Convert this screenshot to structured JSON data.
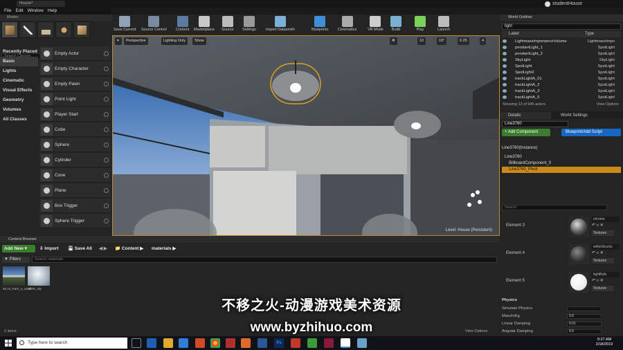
{
  "window": {
    "tab_title": "House*",
    "project": "studentHouse"
  },
  "menu": [
    "File",
    "Edit",
    "Window",
    "Help"
  ],
  "modes": {
    "title": "Modes",
    "search_placeholder": "Search Classes",
    "categories": [
      "Recently Placed",
      "Basic",
      "Lights",
      "Cinematic",
      "Visual Effects",
      "Geometry",
      "Volumes",
      "All Classes"
    ],
    "selected_category": "Basic",
    "actors": [
      "Empty Actor",
      "Empty Character",
      "Empty Pawn",
      "Point Light",
      "Player Start",
      "Cube",
      "Sphere",
      "Cylinder",
      "Cone",
      "Plane",
      "Box Trigger",
      "Sphere Trigger"
    ]
  },
  "toolbar": [
    "Save Current",
    "Source Control",
    "Content",
    "Marketplace",
    "Source",
    "Settings",
    "Import Datasmith",
    "Blueprints",
    "Cinematics",
    "VR Mode",
    "Build",
    "Play",
    "Launch"
  ],
  "viewport": {
    "perspective": "Perspective",
    "lighting": "Lighting Only",
    "show": "Show",
    "grid": "10",
    "angle": "10°",
    "scale": "0.25",
    "cam": "4",
    "level_label": "Level:",
    "level_name": "House (Persistent)"
  },
  "outliner": {
    "title": "World Outliner",
    "search": "light",
    "col_label": "Label",
    "col_type": "Type",
    "rows": [
      {
        "name": "LightmassImportanceVolume",
        "type": "LightmassImpo"
      },
      {
        "name": "pendantLight_1",
        "type": "SpotLight"
      },
      {
        "name": "pendantLight_2",
        "type": "SpotLight"
      },
      {
        "name": "SkyLight",
        "type": "SkyLight"
      },
      {
        "name": "SpotLight",
        "type": "SpotLight"
      },
      {
        "name": "SpotLight2",
        "type": "SpotLight"
      },
      {
        "name": "trackLightA_01",
        "type": "SpotLight"
      },
      {
        "name": "trackLightA_2",
        "type": "SpotLight"
      },
      {
        "name": "trackLightA_3",
        "type": "SpotLight"
      },
      {
        "name": "trackLightA_5",
        "type": "SpotLight"
      }
    ],
    "footer": "Showing 13 of 546 actors",
    "view_options": "View Options"
  },
  "details": {
    "tab_details": "Details",
    "tab_world": "World Settings",
    "name": "Line3760",
    "add_component": "+ Add Component",
    "blueprint": "Blueprint/Add Script",
    "instance": "Line3760(Instance)",
    "components": [
      "Line3760",
      "BillboardComponent_0",
      "Line3760_Pivot"
    ],
    "search": "Search",
    "elements": [
      {
        "label": "Element 3",
        "material": "chrome",
        "tex": "Textures"
      },
      {
        "label": "Element 4",
        "material": "whiteStructu",
        "tex": "Textures"
      },
      {
        "label": "Element 5",
        "material": "lightBulb",
        "tex": "Textures"
      }
    ],
    "physics_title": "Physics",
    "physics": [
      {
        "label": "Simulate Physics",
        "value": ""
      },
      {
        "label": "MassInKg",
        "value": "0.0"
      },
      {
        "label": "Linear Damping",
        "value": "0.01"
      },
      {
        "label": "Angular Damping",
        "value": "0.0"
      }
    ]
  },
  "content": {
    "title": "Content Browser",
    "add_new": "Add New",
    "import": "Import",
    "save_all": "Save All",
    "path": [
      "Content",
      "materials"
    ],
    "filters": "Filters",
    "search_placeholder": "Search materials",
    "assets": [
      {
        "name": "09.10_Park_4_small"
      },
      {
        "name": "HDRI_sky"
      }
    ],
    "items": "2 items",
    "view_options": "View Options"
  },
  "watermark": {
    "line1": "不移之火-动漫游戏美术资源",
    "line2": "www.byzhihuo.com"
  },
  "taskbar": {
    "search": "Type here to search",
    "time": "9:27 AM",
    "date": "2/18/2019"
  }
}
